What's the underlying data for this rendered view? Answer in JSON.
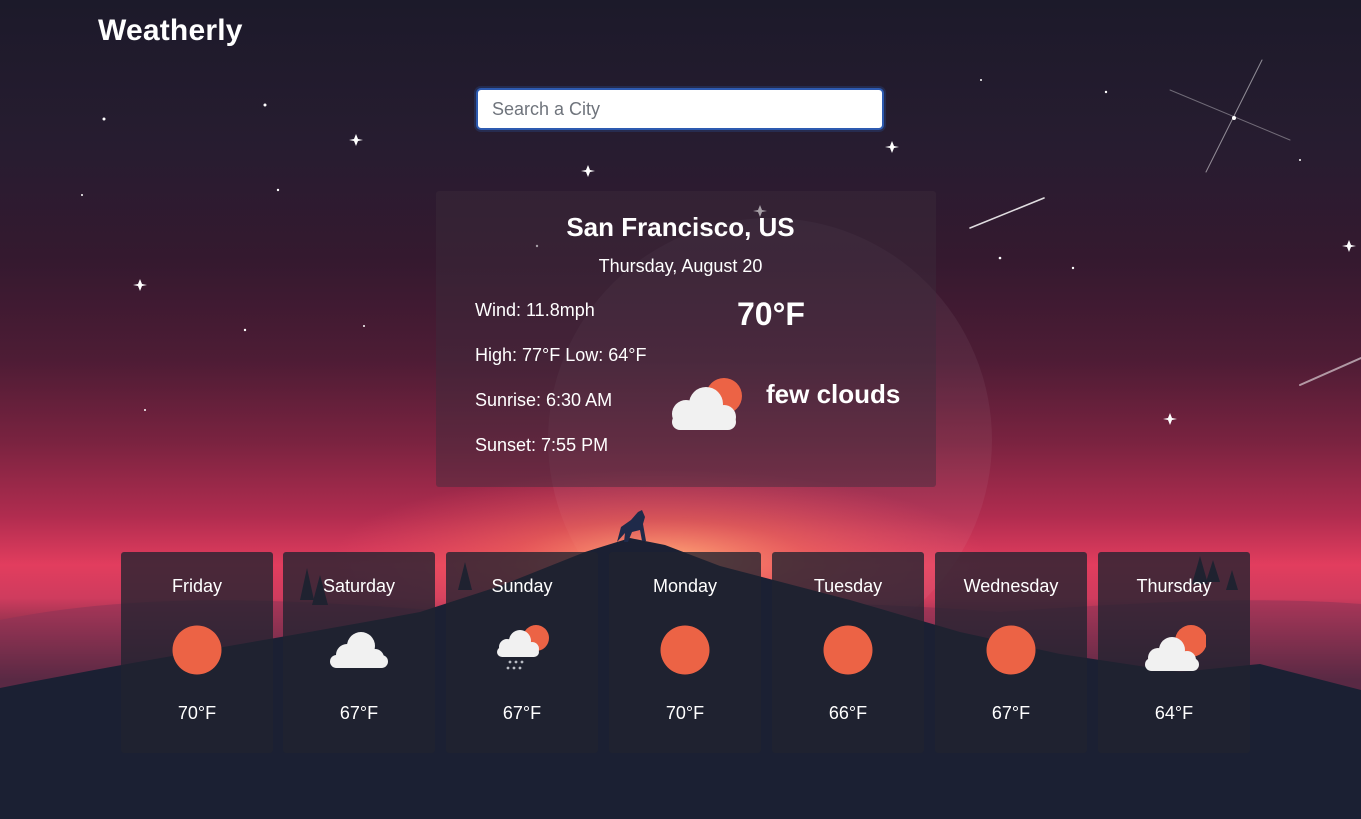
{
  "app": {
    "brand": "Weatherly"
  },
  "search": {
    "placeholder": "Search a City",
    "value": ""
  },
  "current": {
    "city": "San Francisco, US",
    "date": "Thursday, August 20",
    "wind": "Wind: 11.8mph",
    "high_low": "High: 77°F Low: 64°F",
    "sunrise": "Sunrise: 6:30 AM",
    "sunset": "Sunset: 7:55 PM",
    "temperature": "70°F",
    "condition": "few clouds",
    "icon": "cloud-sun-icon"
  },
  "forecast": [
    {
      "day": "Friday",
      "temp": "70°F",
      "icon": "sun-icon"
    },
    {
      "day": "Saturday",
      "temp": "67°F",
      "icon": "cloud-icon"
    },
    {
      "day": "Sunday",
      "temp": "67°F",
      "icon": "rain-cloud-sun-icon"
    },
    {
      "day": "Monday",
      "temp": "70°F",
      "icon": "sun-icon"
    },
    {
      "day": "Tuesday",
      "temp": "66°F",
      "icon": "sun-icon"
    },
    {
      "day": "Wednesday",
      "temp": "67°F",
      "icon": "sun-icon"
    },
    {
      "day": "Thursday",
      "temp": "64°F",
      "icon": "cloud-sun-icon"
    }
  ],
  "colors": {
    "sun": "#ec6345",
    "cloud": "#f1f1f1",
    "search_border": "#2d5ab0",
    "mountain": "#1b2033"
  }
}
